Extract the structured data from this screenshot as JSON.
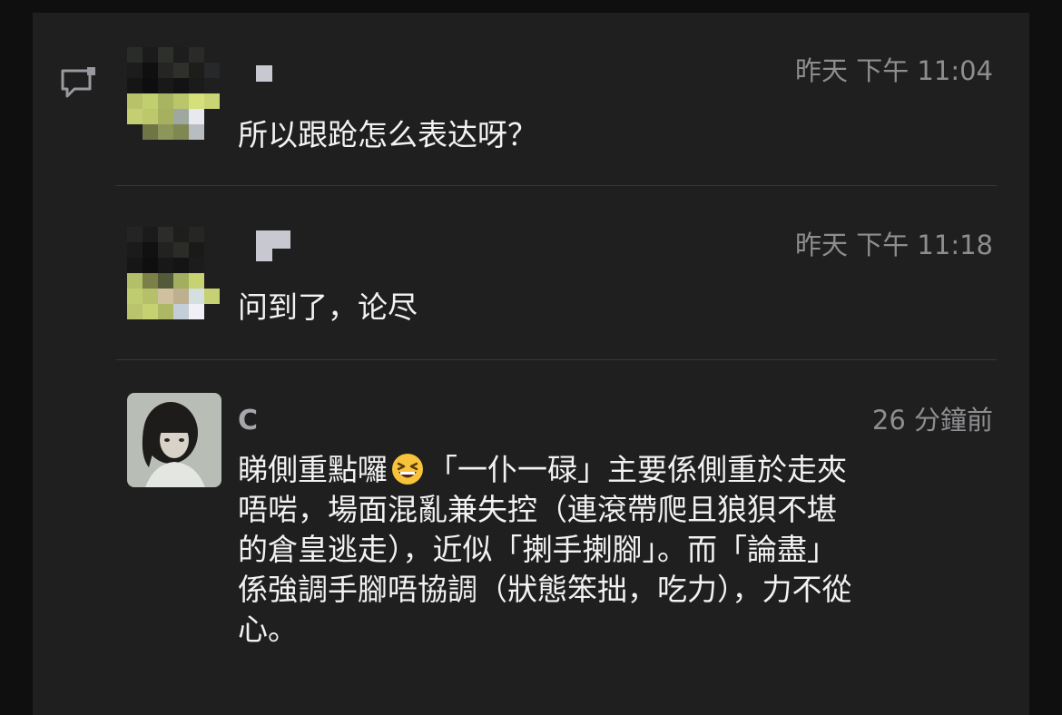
{
  "messages": [
    {
      "timestamp": "昨天 下午 11:04",
      "text": "所以跟跄怎么表达呀？"
    },
    {
      "timestamp": "昨天 下午 11:18",
      "text": "问到了，论尽"
    },
    {
      "username": "C",
      "timestamp": "26 分鐘前",
      "lines": [
        "睇側重點囉",
        "「一仆一碌」主要係側重於走夾",
        "唔啱，場面混亂兼失控（連滾帶爬且狼狽不堪",
        "的倉皇逃走），近似「揦手揦腳」。而「論盡」",
        "係強調手腳唔協調（狀態笨拙，吃力），力不從",
        "心。"
      ],
      "emoji": "grinning-squinting-face"
    }
  ],
  "icons": {
    "reply": "reply-comment-icon"
  },
  "colors": {
    "background": "#1f1f20",
    "text": "#f2f2f2",
    "timestamp": "#8e8e90",
    "divider": "#38383a"
  }
}
